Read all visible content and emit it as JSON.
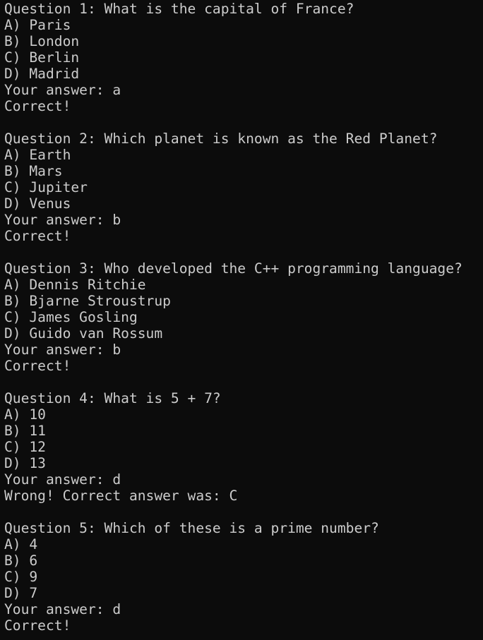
{
  "questions": [
    {
      "question": "Question 1: What is the capital of France?",
      "options": [
        "A) Paris",
        "B) London",
        "C) Berlin",
        "D) Madrid"
      ],
      "answer": "Your answer: a",
      "result": "Correct!"
    },
    {
      "question": "Question 2: Which planet is known as the Red Planet?",
      "options": [
        "A) Earth",
        "B) Mars",
        "C) Jupiter",
        "D) Venus"
      ],
      "answer": "Your answer: b",
      "result": "Correct!"
    },
    {
      "question": "Question 3: Who developed the C++ programming language?",
      "options": [
        "A) Dennis Ritchie",
        "B) Bjarne Stroustrup",
        "C) James Gosling",
        "D) Guido van Rossum"
      ],
      "answer": "Your answer: b",
      "result": "Correct!"
    },
    {
      "question": "Question 4: What is 5 + 7?",
      "options": [
        "A) 10",
        "B) 11",
        "C) 12",
        "D) 13"
      ],
      "answer": "Your answer: d",
      "result": "Wrong! Correct answer was: C"
    },
    {
      "question": "Question 5: Which of these is a prime number?",
      "options": [
        "A) 4",
        "B) 6",
        "C) 9",
        "D) 7"
      ],
      "answer": "Your answer: d",
      "result": "Correct!"
    }
  ]
}
